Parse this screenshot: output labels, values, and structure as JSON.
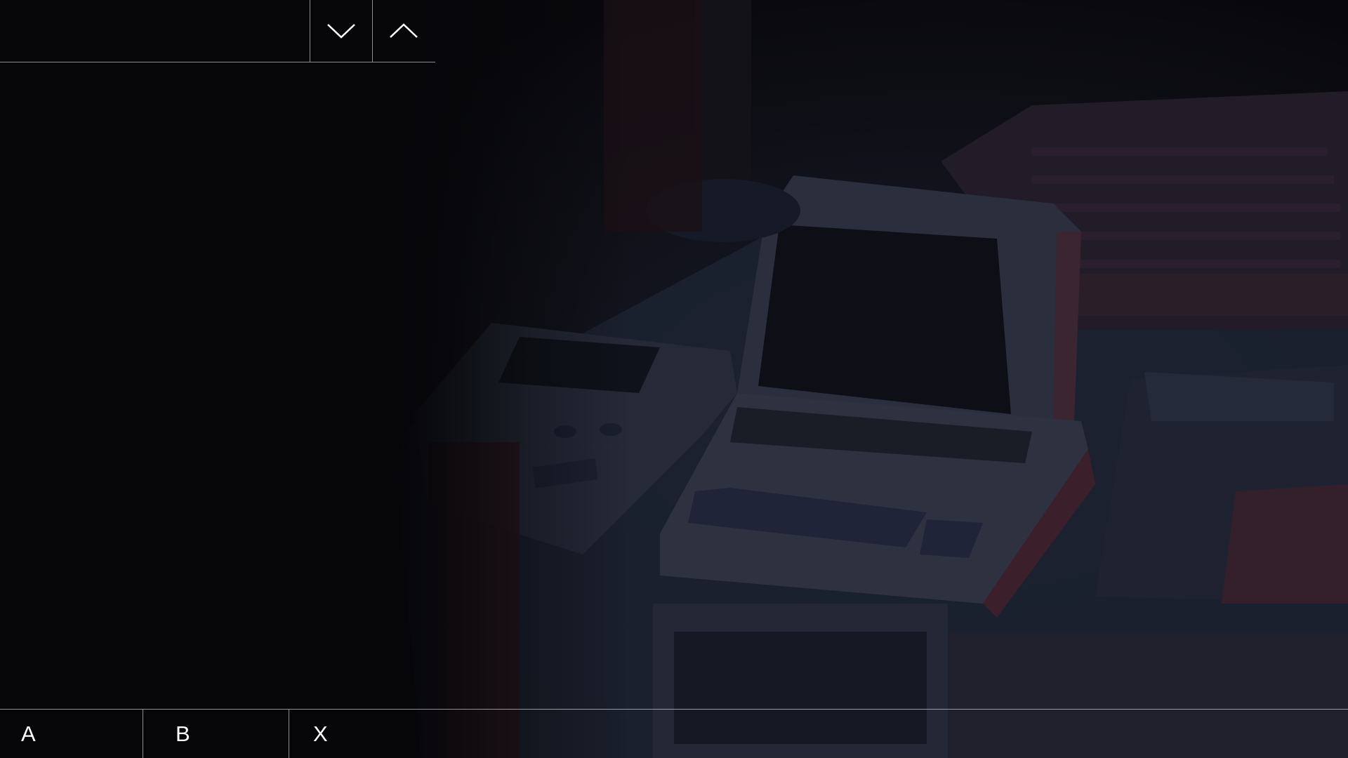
{
  "top_bar": {
    "scroll_down_icon": "chevron-down-icon",
    "scroll_up_icon": "chevron-up-icon"
  },
  "background": {
    "subject": "retro-computers-and-handheld-console"
  },
  "bottom_bar": {
    "buttons": [
      {
        "label": "A"
      },
      {
        "label": "B"
      },
      {
        "label": "X"
      }
    ]
  },
  "colors": {
    "background": "#07070a",
    "divider": "#ffffff",
    "accent_red": "#8a2630",
    "accent_blue": "#2a3550"
  }
}
